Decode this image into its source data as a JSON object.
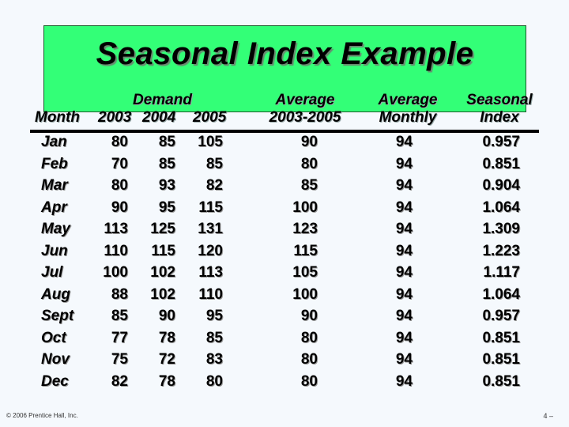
{
  "title": "Seasonal Index Example",
  "headers": {
    "month": "Month",
    "demand": "Demand",
    "years": [
      "2003",
      "2004",
      "2005"
    ],
    "avg_line1": "Average",
    "avg_line2": "2003-2005",
    "monthly_line1": "Average",
    "monthly_line2": "Monthly",
    "index_line1": "Seasonal",
    "index_line2": "Index"
  },
  "rows": [
    {
      "month": "Jan",
      "d2003": "80",
      "d2004": "85",
      "d2005": "105",
      "avg": "90",
      "monthly": "94",
      "index": "0.957"
    },
    {
      "month": "Feb",
      "d2003": "70",
      "d2004": "85",
      "d2005": "85",
      "avg": "80",
      "monthly": "94",
      "index": "0.851"
    },
    {
      "month": "Mar",
      "d2003": "80",
      "d2004": "93",
      "d2005": "82",
      "avg": "85",
      "monthly": "94",
      "index": "0.904"
    },
    {
      "month": "Apr",
      "d2003": "90",
      "d2004": "95",
      "d2005": "115",
      "avg": "100",
      "monthly": "94",
      "index": "1.064"
    },
    {
      "month": "May",
      "d2003": "113",
      "d2004": "125",
      "d2005": "131",
      "avg": "123",
      "monthly": "94",
      "index": "1.309"
    },
    {
      "month": "Jun",
      "d2003": "110",
      "d2004": "115",
      "d2005": "120",
      "avg": "115",
      "monthly": "94",
      "index": "1.223"
    },
    {
      "month": "Jul",
      "d2003": "100",
      "d2004": "102",
      "d2005": "113",
      "avg": "105",
      "monthly": "94",
      "index": "1.117"
    },
    {
      "month": "Aug",
      "d2003": "88",
      "d2004": "102",
      "d2005": "110",
      "avg": "100",
      "monthly": "94",
      "index": "1.064"
    },
    {
      "month": "Sept",
      "d2003": "85",
      "d2004": "90",
      "d2005": "95",
      "avg": "90",
      "monthly": "94",
      "index": "0.957"
    },
    {
      "month": "Oct",
      "d2003": "77",
      "d2004": "78",
      "d2005": "85",
      "avg": "80",
      "monthly": "94",
      "index": "0.851"
    },
    {
      "month": "Nov",
      "d2003": "75",
      "d2004": "72",
      "d2005": "83",
      "avg": "80",
      "monthly": "94",
      "index": "0.851"
    },
    {
      "month": "Dec",
      "d2003": "82",
      "d2004": "78",
      "d2005": "80",
      "avg": "80",
      "monthly": "94",
      "index": "0.851"
    }
  ],
  "footer": {
    "copyright": "© 2006 Prentice Hall, Inc.",
    "page": "4 –"
  },
  "colors": {
    "title_bg": "#33ff77",
    "page_bg": "#f5f9fd"
  }
}
